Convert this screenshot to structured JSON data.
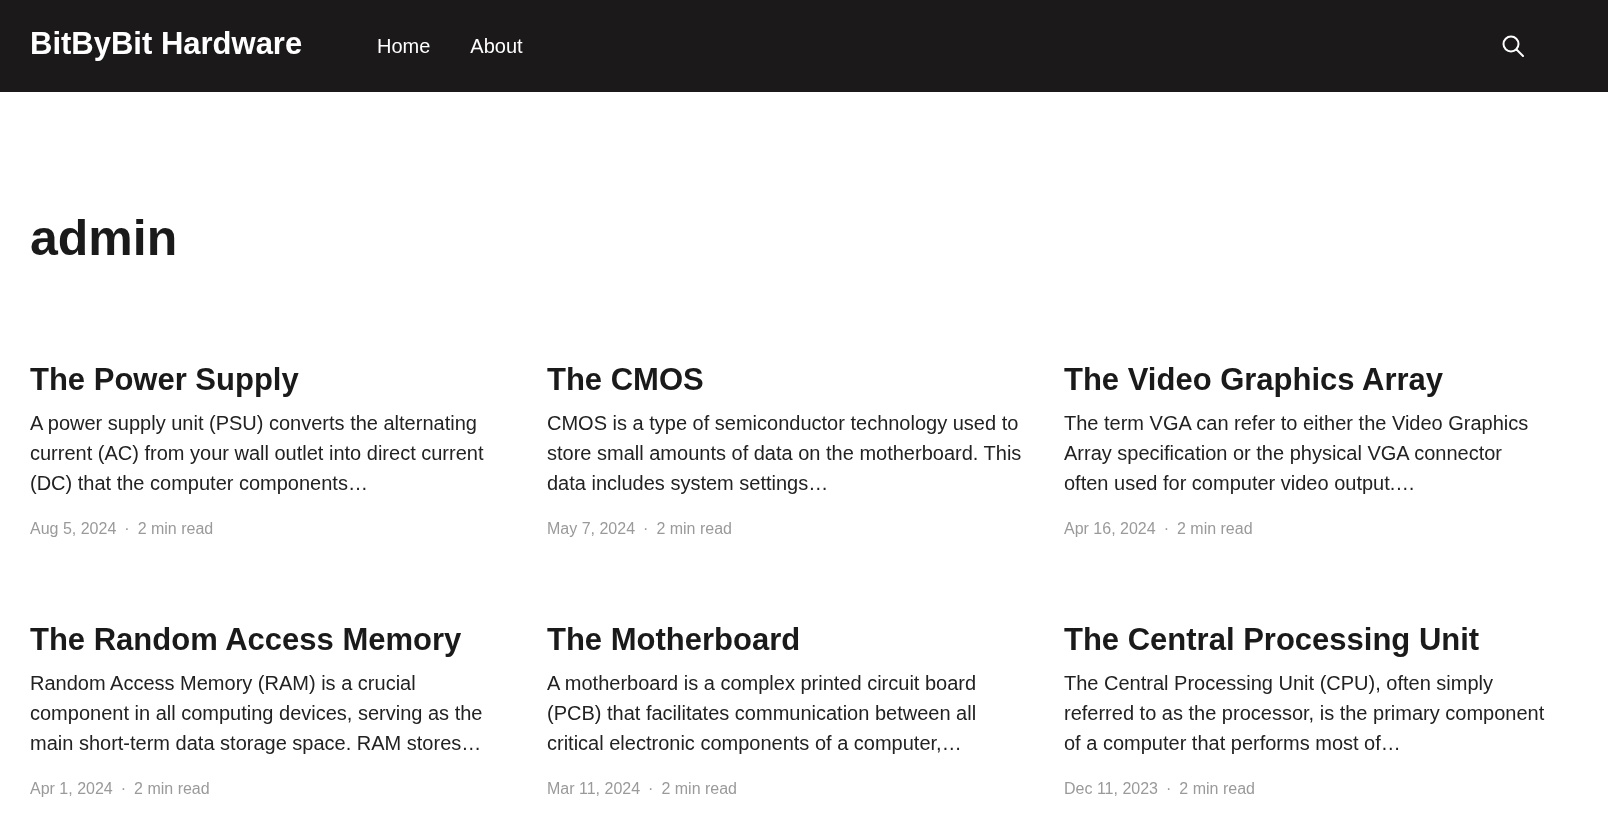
{
  "header": {
    "logo": "BitByBit Hardware",
    "nav": [
      {
        "label": "Home"
      },
      {
        "label": "About"
      }
    ]
  },
  "page_title": "admin",
  "posts": [
    {
      "title": "The Power Supply",
      "excerpt": "A power supply unit (PSU) converts the alternating current (AC) from your wall outlet into direct current (DC) that the computer components…",
      "date": "Aug 5, 2024",
      "separator": "·",
      "read_time": "2 min read"
    },
    {
      "title": "The CMOS",
      "excerpt": "CMOS is a type of semiconductor technology used to store small amounts of data on the motherboard. This data includes system settings…",
      "date": "May 7, 2024",
      "separator": "·",
      "read_time": "2 min read"
    },
    {
      "title": "The Video Graphics Array",
      "excerpt": "The term VGA can refer to either the Video Graphics Array specification or the physical VGA connector often used for computer video output.…",
      "date": "Apr 16, 2024",
      "separator": "·",
      "read_time": "2 min read"
    },
    {
      "title": "The Random Access Memory",
      "excerpt": "Random Access Memory (RAM) is a crucial component in all computing devices, serving as the main short-term data storage space. RAM stores…",
      "date": "Apr 1, 2024",
      "separator": "·",
      "read_time": "2 min read"
    },
    {
      "title": "The Motherboard",
      "excerpt": "A motherboard is a complex printed circuit board (PCB) that facilitates communication between all critical electronic components of a computer,…",
      "date": "Mar 11, 2024",
      "separator": "·",
      "read_time": "2 min read"
    },
    {
      "title": "The Central Processing Unit",
      "excerpt": "The Central Processing Unit (CPU), often simply referred to as the processor, is the primary component of a computer that performs most of…",
      "date": "Dec 11, 2023",
      "separator": "·",
      "read_time": "2 min read"
    }
  ]
}
